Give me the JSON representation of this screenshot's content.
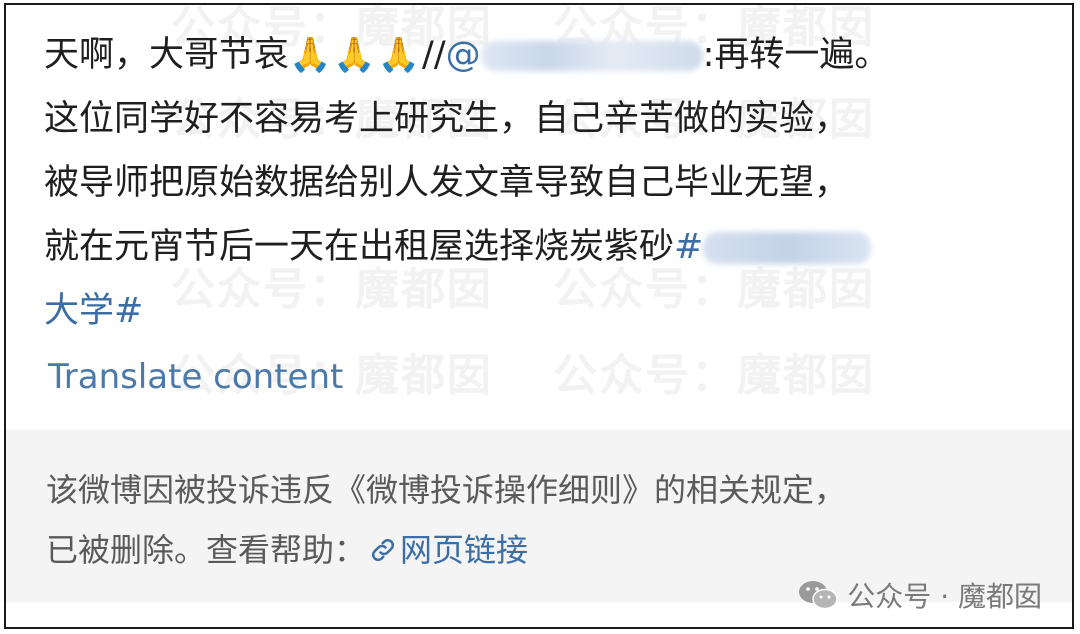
{
  "post": {
    "line1_pre": "天啊，大哥节哀",
    "pray_emoji": "🙏",
    "line1_slashes": "//",
    "line1_at": "@",
    "line1_post": ":再转一遍。",
    "line2": "这位同学好不容易考上研究生，自己辛苦做的实验，",
    "line3": "被导师把原始数据给别人发文章导致自己毕业无望，",
    "line4_pre": "就在元宵节后一天在出租屋选择烧炭紫砂",
    "line4_hash": "#",
    "line5": "大学#"
  },
  "translate_label": "Translate content",
  "notice": {
    "line1": "该微博因被投诉违反《微博投诉操作细则》的相关规定，",
    "line2_pre": "已被删除。查看帮助：",
    "link_label": "网页链接"
  },
  "watermark": {
    "text": "公众号：魔都囡",
    "footer": "公众号 · 魔都囡"
  },
  "colors": {
    "link": "#3b6ea5",
    "text": "#1f1f1f",
    "notice_bg": "#f4f4f4"
  }
}
